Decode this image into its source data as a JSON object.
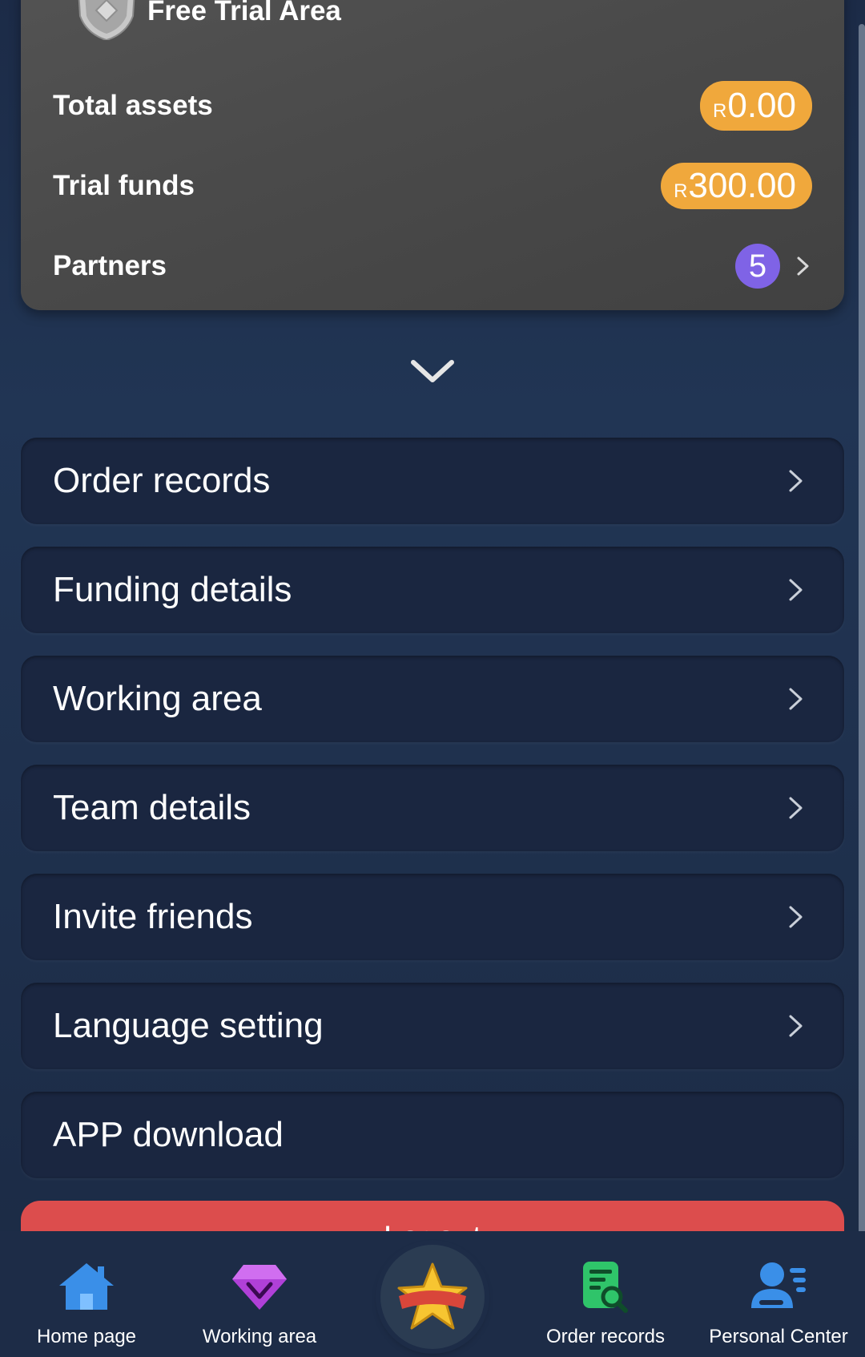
{
  "trial_card": {
    "title": "Free Trial Area",
    "total_assets_label": "Total assets",
    "total_assets_currency": "R",
    "total_assets_value": "0.00",
    "trial_funds_label": "Trial funds",
    "trial_funds_currency": "R",
    "trial_funds_value": "300.00",
    "partners_label": "Partners",
    "partners_count": "5"
  },
  "menu": {
    "items": [
      {
        "label": "Order records"
      },
      {
        "label": "Funding details"
      },
      {
        "label": "Working area"
      },
      {
        "label": "Team details"
      },
      {
        "label": "Invite friends"
      },
      {
        "label": "Language setting"
      },
      {
        "label": "APP download"
      }
    ],
    "logout_label": "Logout"
  },
  "bottom_nav": {
    "items": [
      {
        "label": "Home page",
        "icon": "home-icon"
      },
      {
        "label": "Working area",
        "icon": "diamond-icon"
      },
      {
        "label": "",
        "icon": "star-badge-icon"
      },
      {
        "label": "Order records",
        "icon": "order-search-icon"
      },
      {
        "label": "Personal Center",
        "icon": "person-icon"
      }
    ]
  },
  "colors": {
    "background": "#1e2f4b",
    "card": "#4a4a4a",
    "badge": "#f0a83c",
    "partner_badge": "#7f63e6",
    "menu_item": "#1a2640",
    "logout": "#dc4d4d",
    "home_icon": "#3a8fe8",
    "diamond_icon": "#b040d8",
    "order_icon": "#2fc46a",
    "person_icon": "#3a8fe8"
  }
}
